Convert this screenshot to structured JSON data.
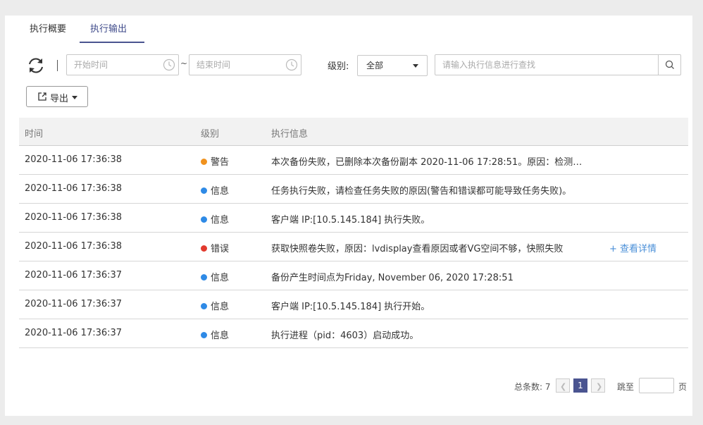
{
  "tabs": [
    {
      "label": "执行概要"
    },
    {
      "label": "执行输出"
    }
  ],
  "toolbar": {
    "start_placeholder": "开始时间",
    "range_sep": "~",
    "end_placeholder": "结束时间",
    "level_label": "级别:",
    "level_value": "全部",
    "search_placeholder": "请输入执行信息进行查找",
    "export_label": "导出"
  },
  "table": {
    "headers": {
      "time": "时间",
      "level": "级别",
      "message": "执行信息"
    },
    "rows": [
      {
        "time": "2020-11-06 17:36:38",
        "level": "警告",
        "message": "本次备份失败，已删除本次备份副本 2020-11-06 17:28:51。原因：检测…"
      },
      {
        "time": "2020-11-06 17:36:38",
        "level": "信息",
        "message": "任务执行失败，请检查任务失败的原因(警告和错误都可能导致任务失败)。"
      },
      {
        "time": "2020-11-06 17:36:38",
        "level": "信息",
        "message": "客户端 IP:[10.5.145.184] 执行失败。"
      },
      {
        "time": "2020-11-06 17:36:38",
        "level": "错误",
        "message": "获取快照卷失败，原因：lvdisplay查看原因或者VG空间不够，快照失败",
        "link": "+ 查看详情"
      },
      {
        "time": "2020-11-06 17:36:37",
        "level": "信息",
        "message": "备份产生时间点为Friday, November 06, 2020 17:28:51"
      },
      {
        "time": "2020-11-06 17:36:37",
        "level": "信息",
        "message": "客户端 IP:[10.5.145.184] 执行开始。"
      },
      {
        "time": "2020-11-06 17:36:37",
        "level": "信息",
        "message": "执行进程（pid：4603）启动成功。"
      }
    ]
  },
  "level_colors": {
    "警告": "#f0921e",
    "信息": "#2e8ae6",
    "错误": "#e23a2e"
  },
  "pagination": {
    "total": "总条数: 7",
    "current": "1",
    "jump_label": "跳至",
    "page_label": "页"
  },
  "colors": {
    "accent": "#4a5490",
    "link": "#4a8fd8"
  }
}
